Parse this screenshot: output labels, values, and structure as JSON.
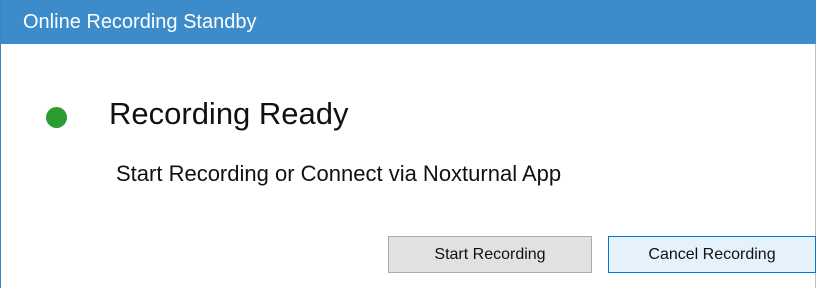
{
  "window": {
    "title": "Online Recording Standby"
  },
  "status": {
    "indicator_color": "#2a9c32",
    "heading": "Recording Ready",
    "message": "Start Recording or Connect via Noxturnal App"
  },
  "buttons": {
    "start_label": "Start Recording",
    "cancel_label": "Cancel Recording"
  },
  "colors": {
    "titlebar": "#3c8ccb",
    "focused_button_border": "#0078d7"
  }
}
